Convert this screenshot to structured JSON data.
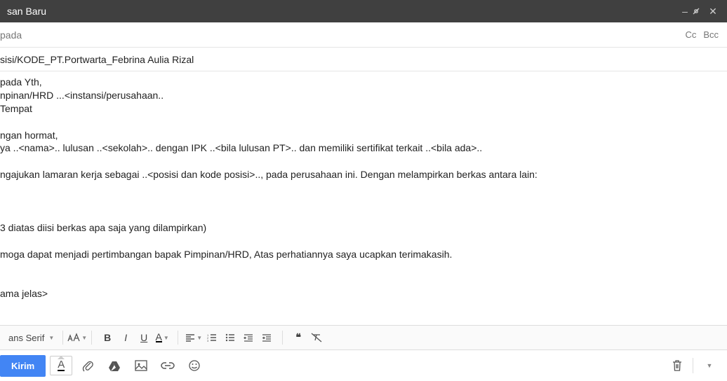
{
  "titlebar": {
    "title": "san Baru"
  },
  "to": {
    "label": "pada",
    "cc": "Cc",
    "bcc": "Bcc"
  },
  "subject": "sisi/KODE_PT.Portwarta_Febrina Aulia Rizal",
  "body": "pada Yth,\nnpinan/HRD ...<instansi/perusahaan..\nTempat\n\nngan hormat,\nya ..<nama>.. lulusan ..<sekolah>.. dengan IPK ..<bila lulusan PT>.. dan memiliki sertifikat terkait ..<bila ada>..\n\nngajukan lamaran kerja sebagai ..<posisi dan kode posisi>.., pada perusahaan ini. Dengan melampirkan berkas antara lain:\n\n\n\n3 diatas diisi berkas apa saja yang dilampirkan)\n\nmoga dapat menjadi pertimbangan bapak Pimpinan/HRD, Atas perhatiannya saya ucapkan terimakasih.\n\n\nama jelas>",
  "format": {
    "font": "ans Serif"
  },
  "send": {
    "label": "Kirim"
  }
}
